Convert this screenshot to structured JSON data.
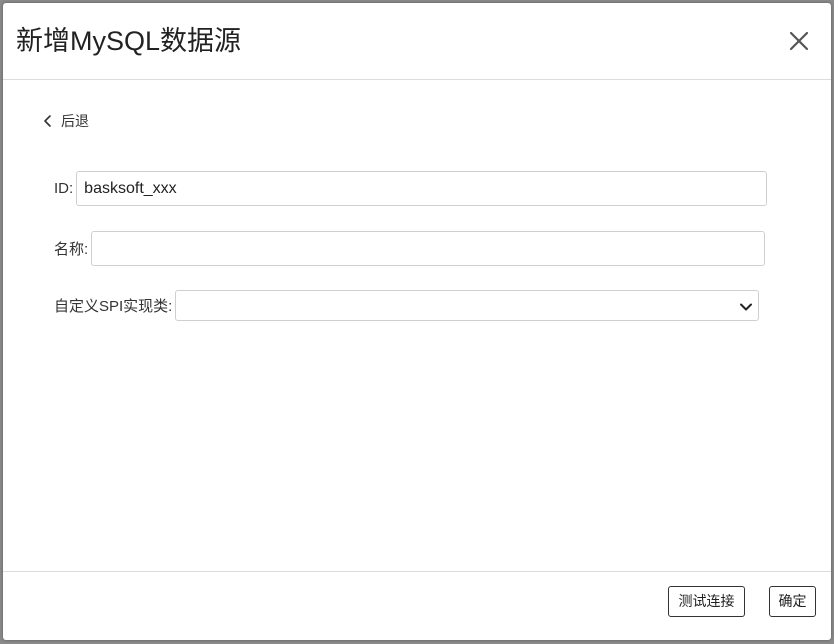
{
  "dialog": {
    "title": "新增MySQL数据源",
    "close_icon": "close-icon"
  },
  "back": {
    "icon": "chevron-left-icon",
    "label": "后退"
  },
  "form": {
    "id": {
      "label": "ID:",
      "value": "basksoft_xxx"
    },
    "name": {
      "label": "名称:",
      "value": ""
    },
    "spi": {
      "label": "自定义SPI实现类:",
      "selected": "",
      "icon": "chevron-down-icon"
    }
  },
  "footer": {
    "test_label": "测试连接",
    "ok_label": "确定"
  }
}
